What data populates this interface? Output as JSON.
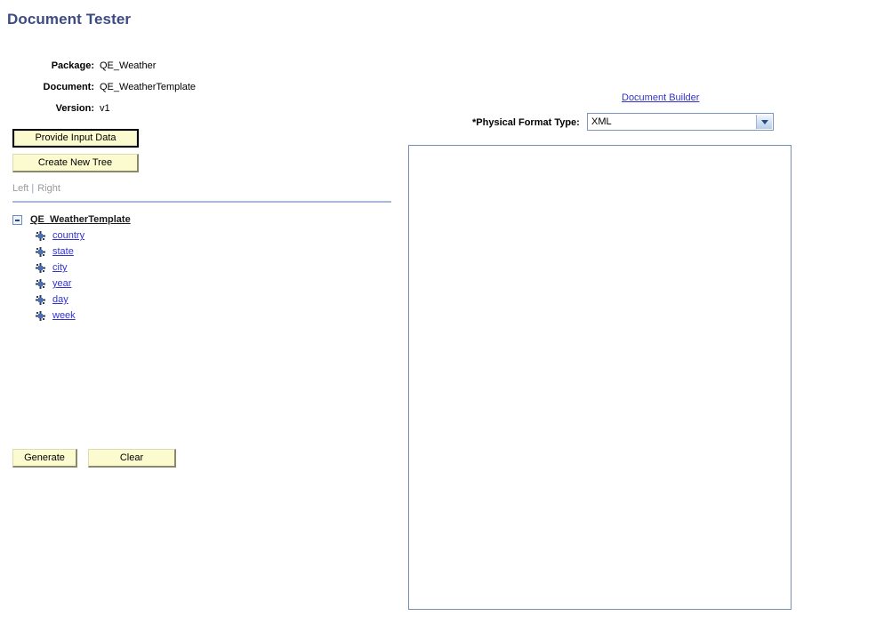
{
  "page": {
    "title": "Document Tester"
  },
  "info": {
    "rows": [
      {
        "label": "Package:",
        "value": "QE_Weather"
      },
      {
        "label": "Document:",
        "value": "QE_WeatherTemplate"
      },
      {
        "label": "Version:",
        "value": "v1"
      }
    ]
  },
  "buttons": {
    "provide_input_data": "Provide Input Data",
    "create_new_tree": "Create New Tree",
    "generate": "Generate",
    "clear": "Clear"
  },
  "side_switch": {
    "left": "Left",
    "separator": "|",
    "right": "Right"
  },
  "tree": {
    "root": {
      "label": "QE_WeatherTemplate",
      "toggle_icon": "minus-box-icon",
      "expanded": true
    },
    "children": [
      {
        "label": "country",
        "icon": "element-node-icon"
      },
      {
        "label": "state",
        "icon": "element-node-icon"
      },
      {
        "label": "city",
        "icon": "element-node-icon"
      },
      {
        "label": "year",
        "icon": "element-node-icon"
      },
      {
        "label": "day",
        "icon": "element-node-icon"
      },
      {
        "label": "week",
        "icon": "element-node-icon"
      }
    ]
  },
  "right_panel": {
    "document_builder_link": "Document Builder",
    "format_label": "*Physical Format Type:",
    "format_value": "XML",
    "format_options": [
      "XML"
    ],
    "output_text": ""
  },
  "colors": {
    "title": "#3c4b84",
    "link": "#3333cc",
    "button_face": "#fbfbcf",
    "panel_border": "#7590b4",
    "rule": "#a9bad9",
    "disabled_text": "#9a9a9a"
  }
}
